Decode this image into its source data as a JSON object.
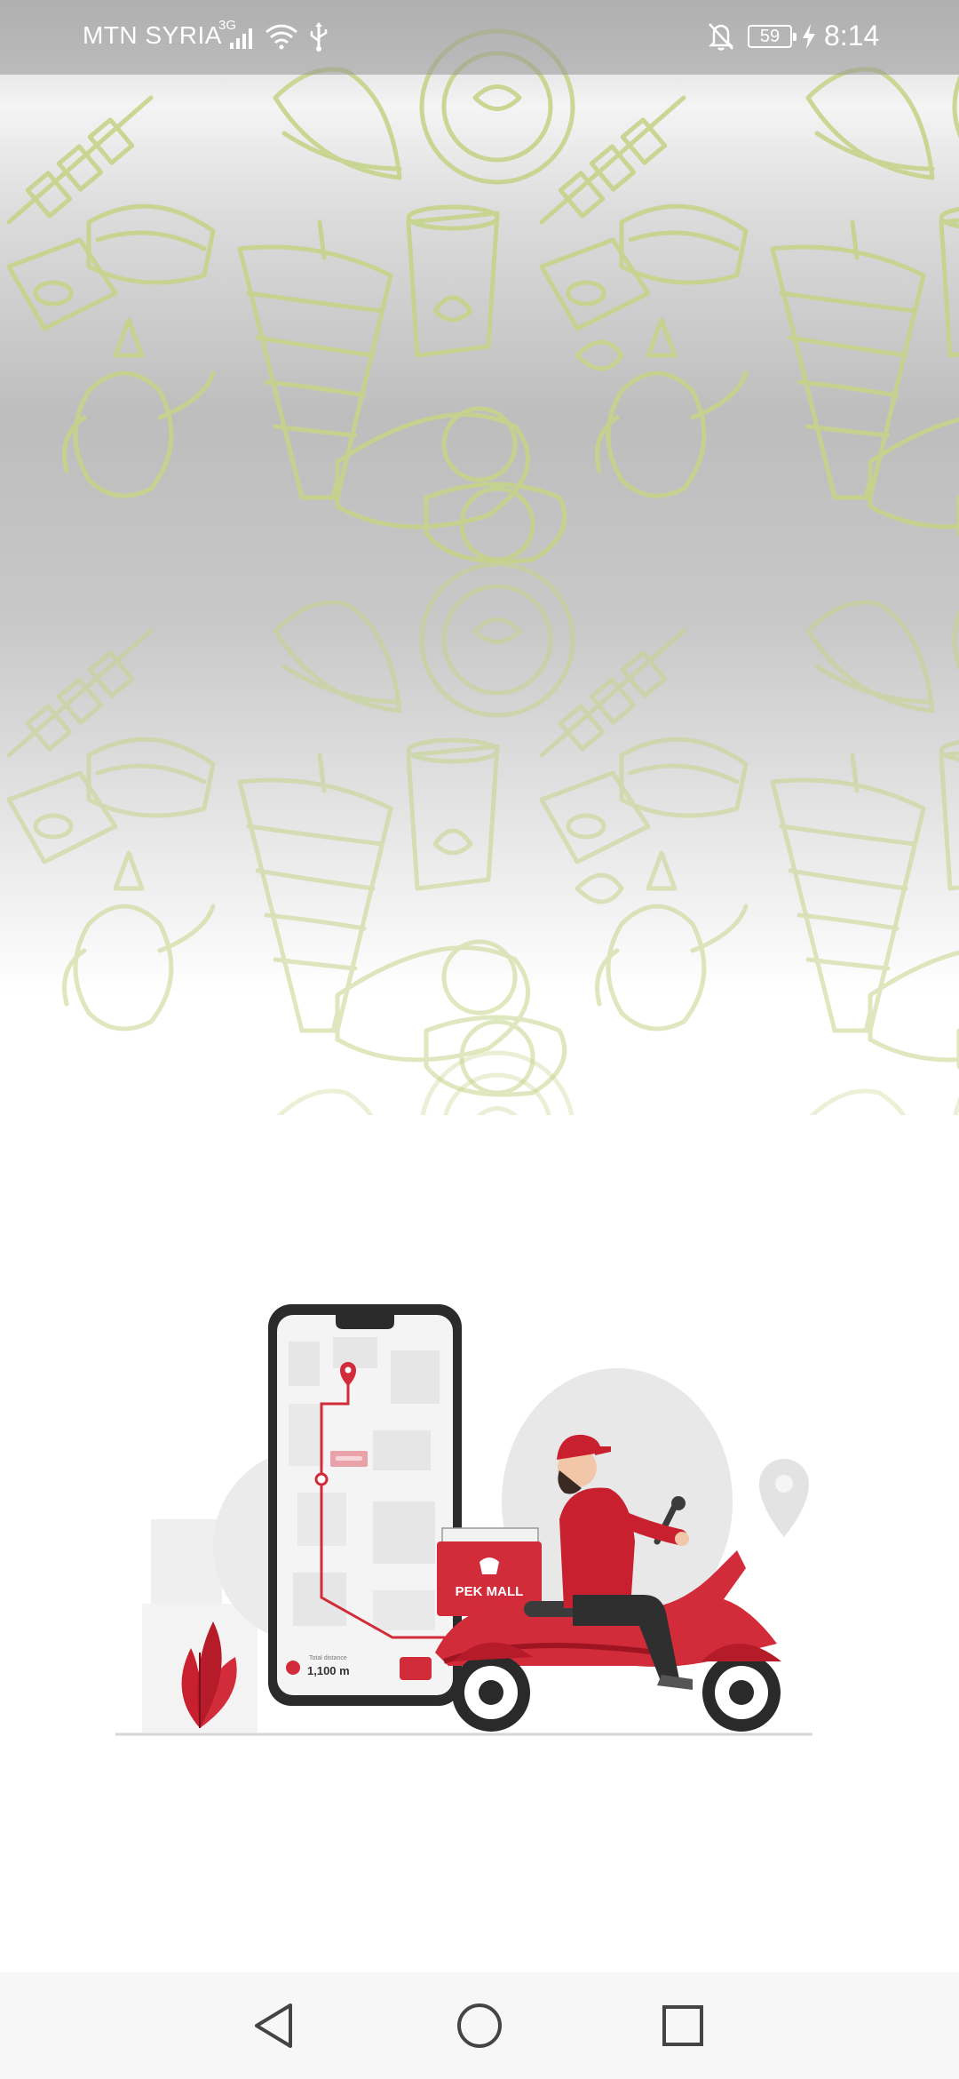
{
  "status_bar": {
    "carrier": "MTN SYRIA",
    "network_type": "3G",
    "battery_level": "59",
    "time": "8:14",
    "icons": [
      "signal-icon",
      "wifi-icon",
      "usb-icon",
      "notifications-off-icon",
      "battery-icon",
      "charging-icon"
    ]
  },
  "illustration": {
    "box_label": "PEK MALL",
    "distance_value": "1,100 m",
    "accent_color": "#d22b3a",
    "pattern_color": "#c8d58a"
  },
  "nav_bar": {
    "icons": [
      "back-icon",
      "home-icon",
      "recents-icon"
    ]
  }
}
